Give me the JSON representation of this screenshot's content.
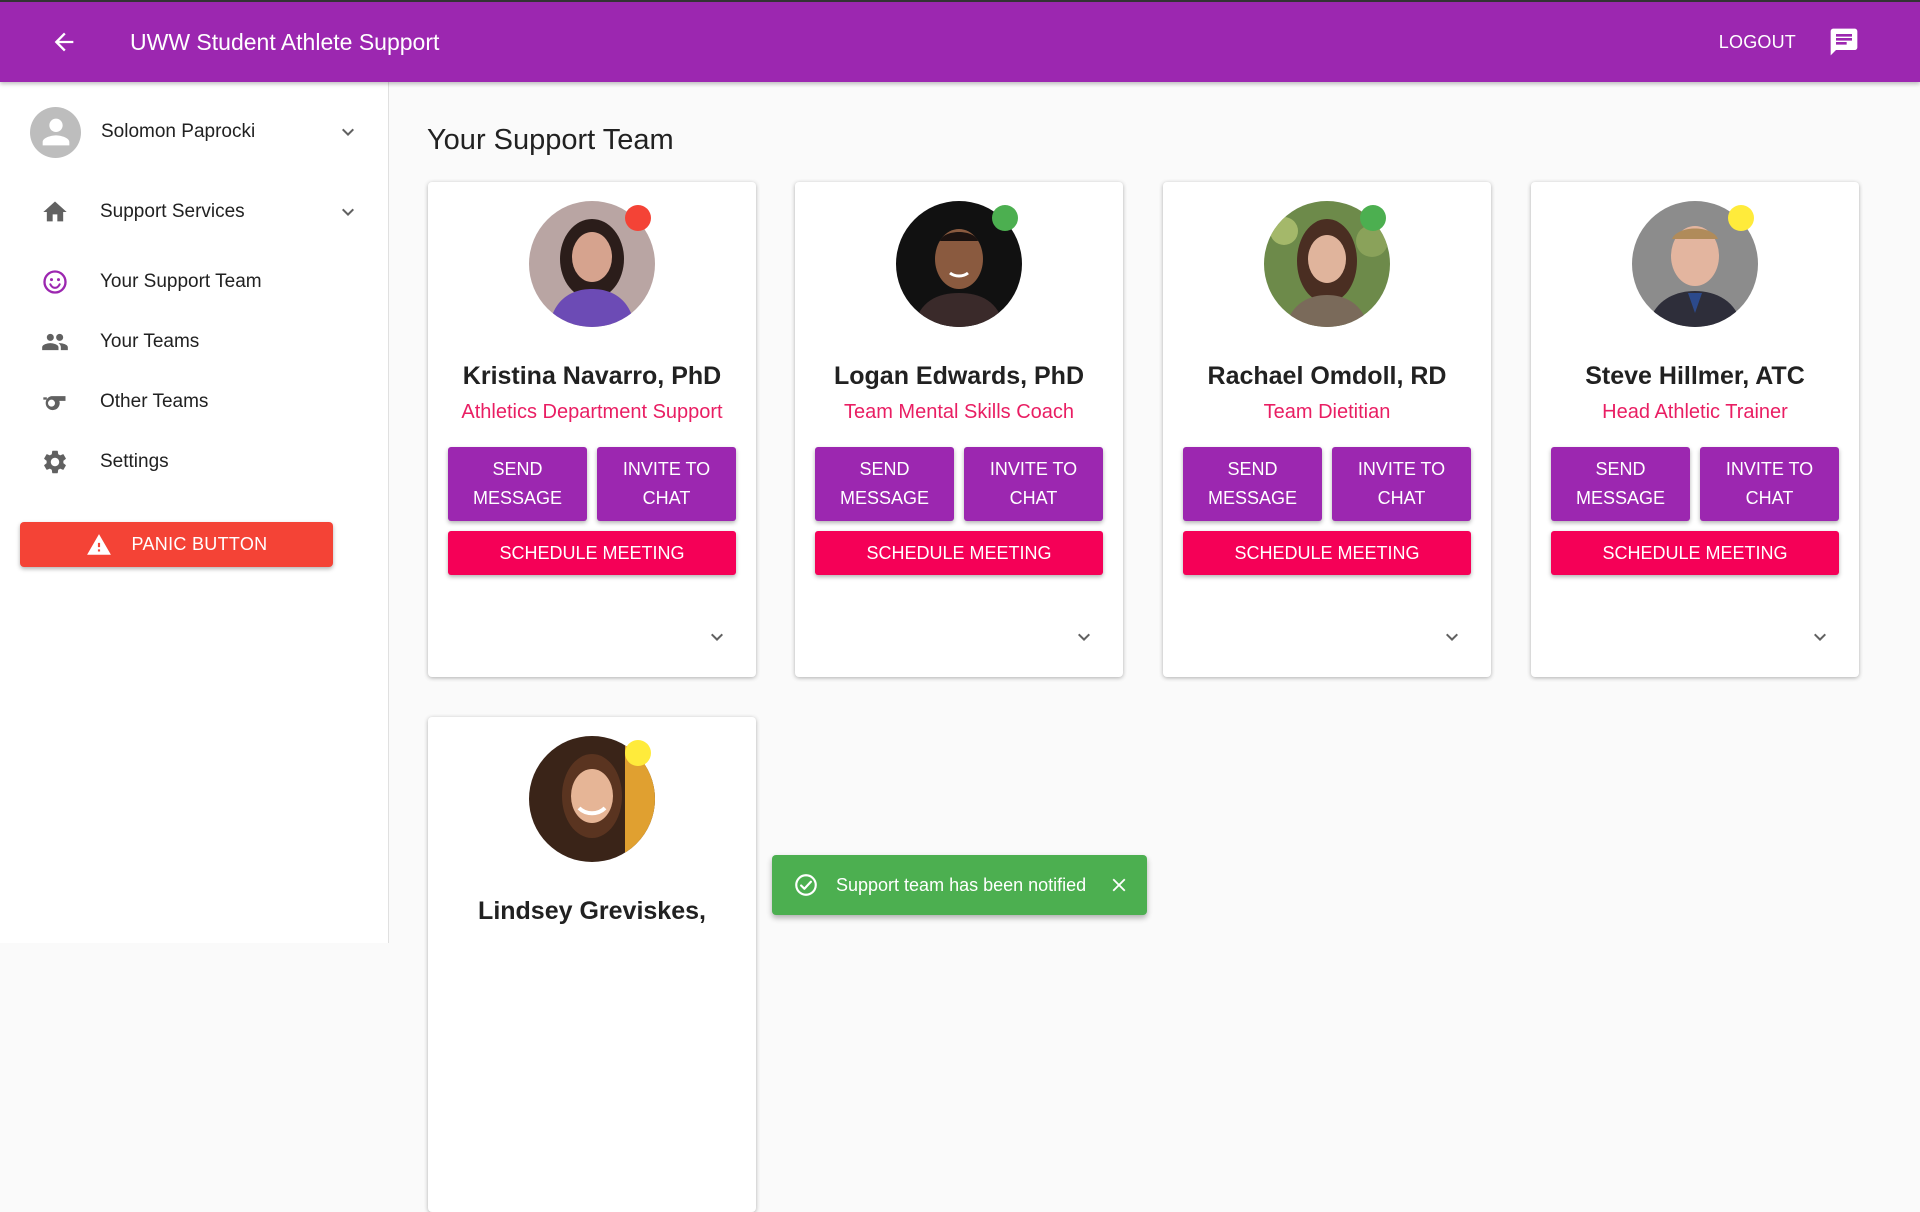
{
  "app": {
    "title": "UWW Student Athlete Support",
    "logout_label": "LOGOUT"
  },
  "sidebar": {
    "user_name": "Solomon Paprocki",
    "items": [
      {
        "label": "Support Services",
        "icon": "home-icon"
      },
      {
        "label": "Your Support Team",
        "icon": "smiley-icon"
      },
      {
        "label": "Your Teams",
        "icon": "people-icon"
      },
      {
        "label": "Other Teams",
        "icon": "whistle-icon"
      },
      {
        "label": "Settings",
        "icon": "gear-icon"
      }
    ],
    "panic_label": "PANIC BUTTON"
  },
  "main": {
    "title": "Your Support Team"
  },
  "buttons": {
    "send": "SEND MESSAGE",
    "invite": "INVITE TO CHAT",
    "schedule": "SCHEDULE MEETING"
  },
  "team": [
    {
      "name": "Kristina Navarro, PhD",
      "role": "Athletics Department Support",
      "status_color": "#f44336"
    },
    {
      "name": "Logan Edwards, PhD",
      "role": "Team Mental Skills Coach",
      "status_color": "#4caf50"
    },
    {
      "name": "Rachael Omdoll, RD",
      "role": "Team Dietitian",
      "status_color": "#4caf50"
    },
    {
      "name": "Steve Hillmer, ATC",
      "role": "Head Athletic Trainer",
      "status_color": "#ffeb3b"
    },
    {
      "name": "Lindsey Greviskes,",
      "role": "",
      "status_color": "#ffeb3b"
    }
  ],
  "snackbar": {
    "message": "Support team has been notified"
  },
  "colors": {
    "primary": "#9c27b0",
    "secondary": "#f50057",
    "panic": "#f44336",
    "success": "#4caf50"
  }
}
